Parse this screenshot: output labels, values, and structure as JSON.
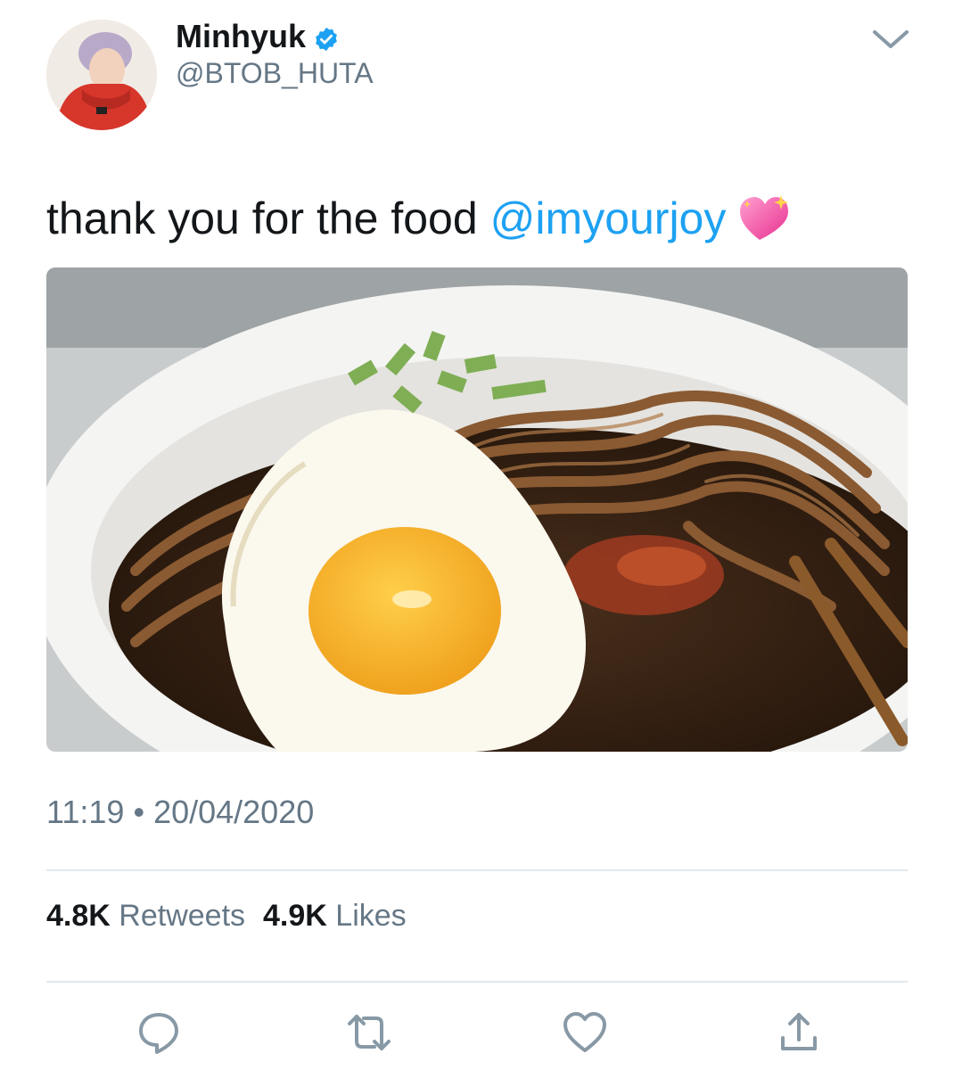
{
  "author": {
    "display_name": "Minhyuk",
    "handle": "@BTOB_HUTA",
    "verified_icon": "verified-badge-icon",
    "avatar_icon": "profile-avatar"
  },
  "tweet": {
    "text": "thank you for the food",
    "mention": "@imyourjoy",
    "emoji_icon": "sparkling-heart-icon",
    "media_alt_icon": "food-photo"
  },
  "meta": {
    "time": "11:19",
    "separator": "•",
    "date": "20/04/2020"
  },
  "stats": {
    "retweets_count": "4.8K",
    "retweets_label": "Retweets",
    "likes_count": "4.9K",
    "likes_label": "Likes"
  },
  "actions": {
    "reply_icon": "reply-icon",
    "retweet_icon": "retweet-icon",
    "like_icon": "heart-icon",
    "share_icon": "share-icon",
    "menu_icon": "chevron-down-icon"
  },
  "colors": {
    "link": "#1da1f2",
    "secondary_text": "#657786",
    "primary_text": "#14171a",
    "divider": "#e1e8ed"
  }
}
